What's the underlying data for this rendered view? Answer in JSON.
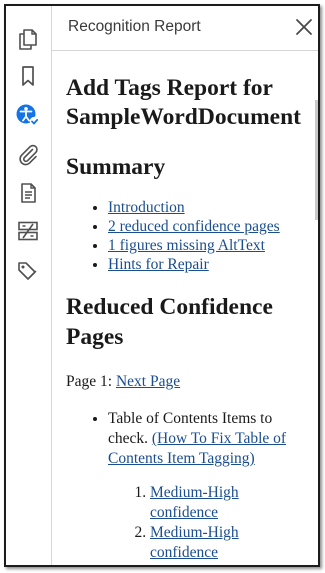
{
  "panel": {
    "title": "Recognition Report",
    "close_label": "×"
  },
  "toolbar": {
    "icons": [
      "pages-icon",
      "bookmark-icon",
      "accessibility-checker-icon",
      "attachment-icon",
      "document-properties-icon",
      "reading-order-icon",
      "tags-icon"
    ],
    "active_icon": "accessibility-checker-icon",
    "accent_color": "#1473e6",
    "icon_color": "#505050"
  },
  "report": {
    "title_line1": "Add Tags Report for",
    "title_line2": "SampleWordDocument",
    "summary_heading": "Summary",
    "summary_links": [
      "Introduction",
      "2 reduced confidence pages",
      "1 figures missing AltText",
      "Hints for Repair"
    ],
    "reduced_heading": "Reduced Confidence Pages",
    "page_label": "Page 1: ",
    "page_link": "Next Page",
    "issue_text": "Table of Contents Items to check. ",
    "issue_link": "(How To Fix Table of Contents Item Tagging)",
    "confidence_items": [
      "Medium-High confidence",
      "Medium-High confidence"
    ]
  },
  "colors": {
    "link": "#1a4e8f",
    "text": "#1a1a1a",
    "border": "#1c1c1c"
  }
}
